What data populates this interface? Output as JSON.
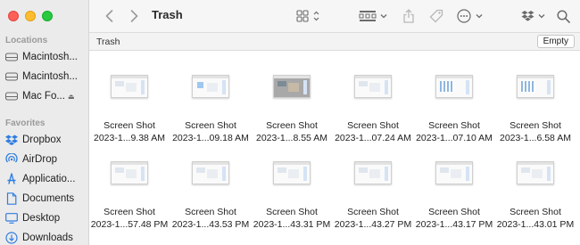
{
  "window": {
    "title": "Trash"
  },
  "sidebar": {
    "sections": [
      {
        "title": "Locations",
        "items": [
          {
            "label": "Macintosh...",
            "icon": "drive-icon"
          },
          {
            "label": "Macintosh...",
            "icon": "drive-icon"
          },
          {
            "label": "Mac Fo...",
            "icon": "drive-icon",
            "eject": "⏏"
          }
        ]
      },
      {
        "title": "Favorites",
        "items": [
          {
            "label": "Dropbox",
            "icon": "dropbox-icon"
          },
          {
            "label": "AirDrop",
            "icon": "airdrop-icon"
          },
          {
            "label": "Applicatio...",
            "icon": "applications-icon"
          },
          {
            "label": "Documents",
            "icon": "document-icon"
          },
          {
            "label": "Desktop",
            "icon": "desktop-icon"
          },
          {
            "label": "Downloads",
            "icon": "downloads-icon"
          }
        ]
      }
    ]
  },
  "pathbar": {
    "title": "Trash",
    "empty_label": "Empty"
  },
  "files": [
    {
      "line1": "Screen Shot",
      "line2": "2023-1...9.38 AM",
      "thumb": "light"
    },
    {
      "line1": "Screen Shot",
      "line2": "2023-1...09.18 AM",
      "thumb": "blue"
    },
    {
      "line1": "Screen Shot",
      "line2": "2023-1...8.55 AM",
      "thumb": "dark"
    },
    {
      "line1": "Screen Shot",
      "line2": "2023-1...07.24 AM",
      "thumb": "light"
    },
    {
      "line1": "Screen Shot",
      "line2": "2023-1...07.10 AM",
      "thumb": "grid-ico"
    },
    {
      "line1": "Screen Shot",
      "line2": "2023-1...6.58 AM",
      "thumb": "grid-ico"
    },
    {
      "line1": "Screen Shot",
      "line2": "2023-1...57.48 PM",
      "thumb": "light"
    },
    {
      "line1": "Screen Shot",
      "line2": "2023-1...43.53 PM",
      "thumb": "light"
    },
    {
      "line1": "Screen Shot",
      "line2": "2023-1...43.31 PM",
      "thumb": "light"
    },
    {
      "line1": "Screen Shot",
      "line2": "2023-1...43.27 PM",
      "thumb": "light"
    },
    {
      "line1": "Screen Shot",
      "line2": "2023-1...43.17 PM",
      "thumb": "light"
    },
    {
      "line1": "Screen Shot",
      "line2": "2023-1...43.01 PM",
      "thumb": "light"
    }
  ],
  "colors": {
    "accent": "#2f7de1",
    "sidebar_bg": "#ebebeb"
  }
}
